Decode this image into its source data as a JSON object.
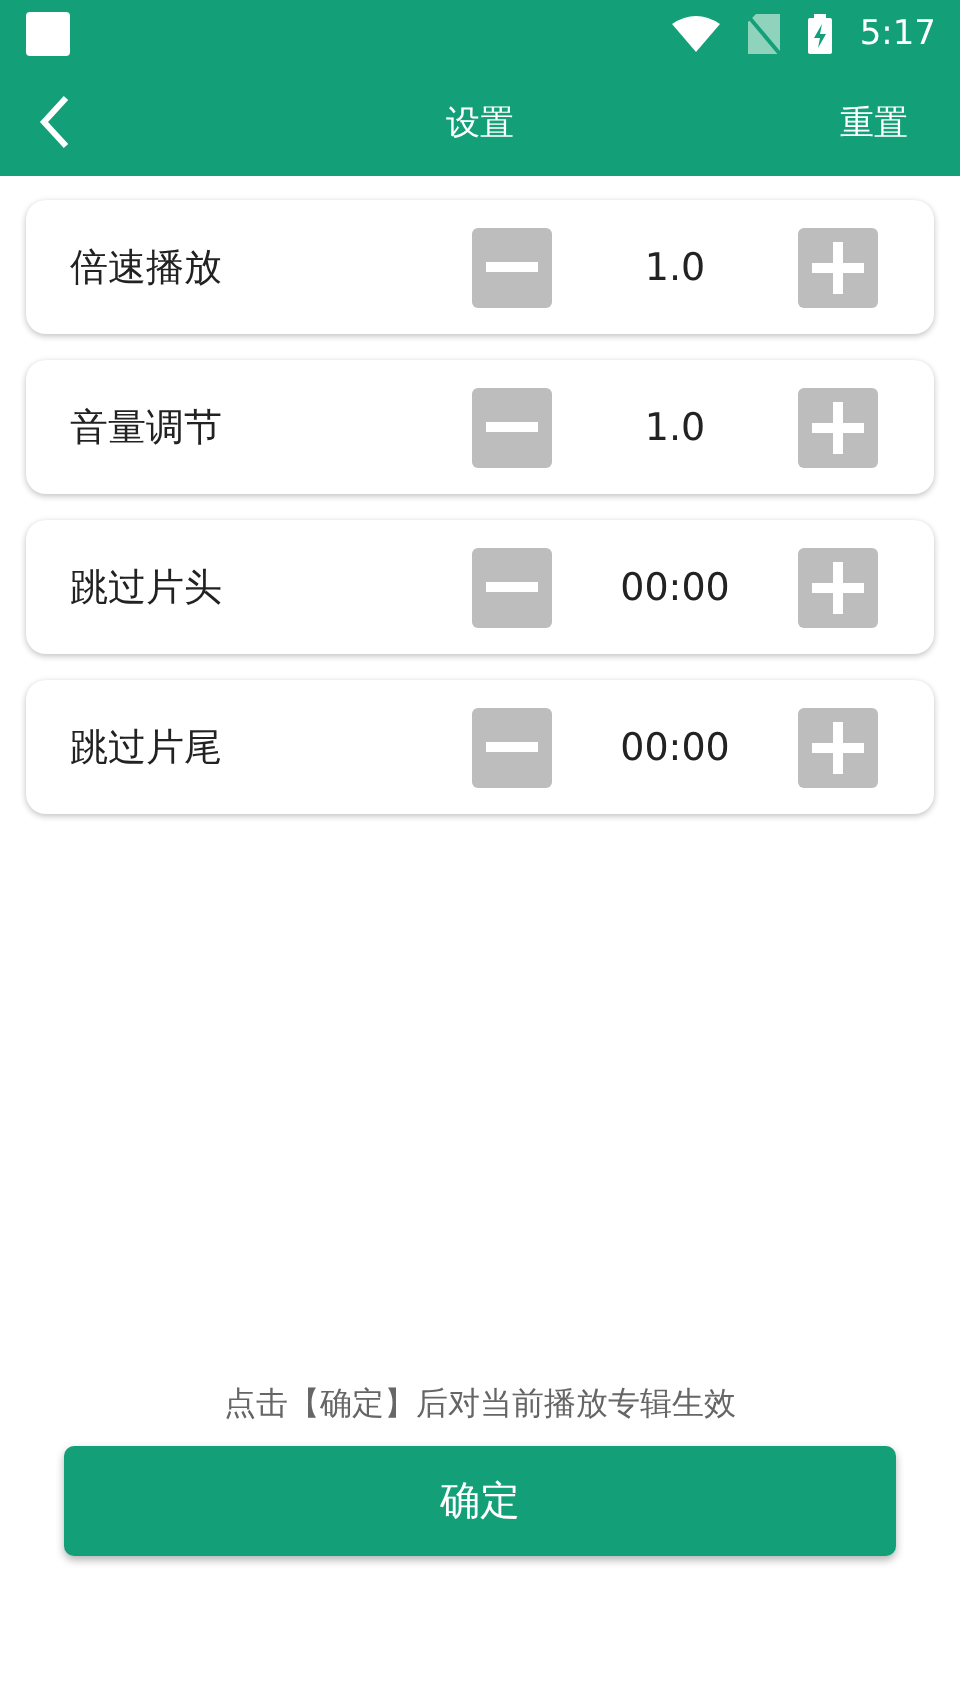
{
  "status_bar": {
    "time": "5:17"
  },
  "header": {
    "title": "设置",
    "action": "重置"
  },
  "settings": [
    {
      "label": "倍速播放",
      "value": "1.0"
    },
    {
      "label": "音量调节",
      "value": "1.0"
    },
    {
      "label": "跳过片头",
      "value": "00:00"
    },
    {
      "label": "跳过片尾",
      "value": "00:00"
    }
  ],
  "hint": "点击【确定】后对当前播放专辑生效",
  "confirm_button": "确定"
}
